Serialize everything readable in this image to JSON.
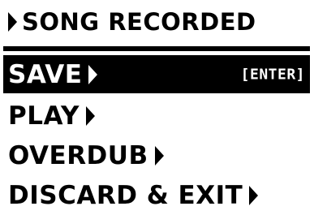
{
  "title": "SONG RECORDED",
  "menu": {
    "items": [
      {
        "label": "SAVE",
        "hint": "[ENTER]",
        "selected": true
      },
      {
        "label": "PLAY"
      },
      {
        "label": "OVERDUB"
      },
      {
        "label": "DISCARD & EXIT"
      }
    ]
  },
  "icons": {
    "title_marker": "triangle-right-icon",
    "submenu_arrow": "triangle-right-icon"
  },
  "colors": {
    "background": "#ffffff",
    "foreground": "#000000",
    "selection_background": "#000000",
    "selection_foreground": "#ffffff"
  }
}
